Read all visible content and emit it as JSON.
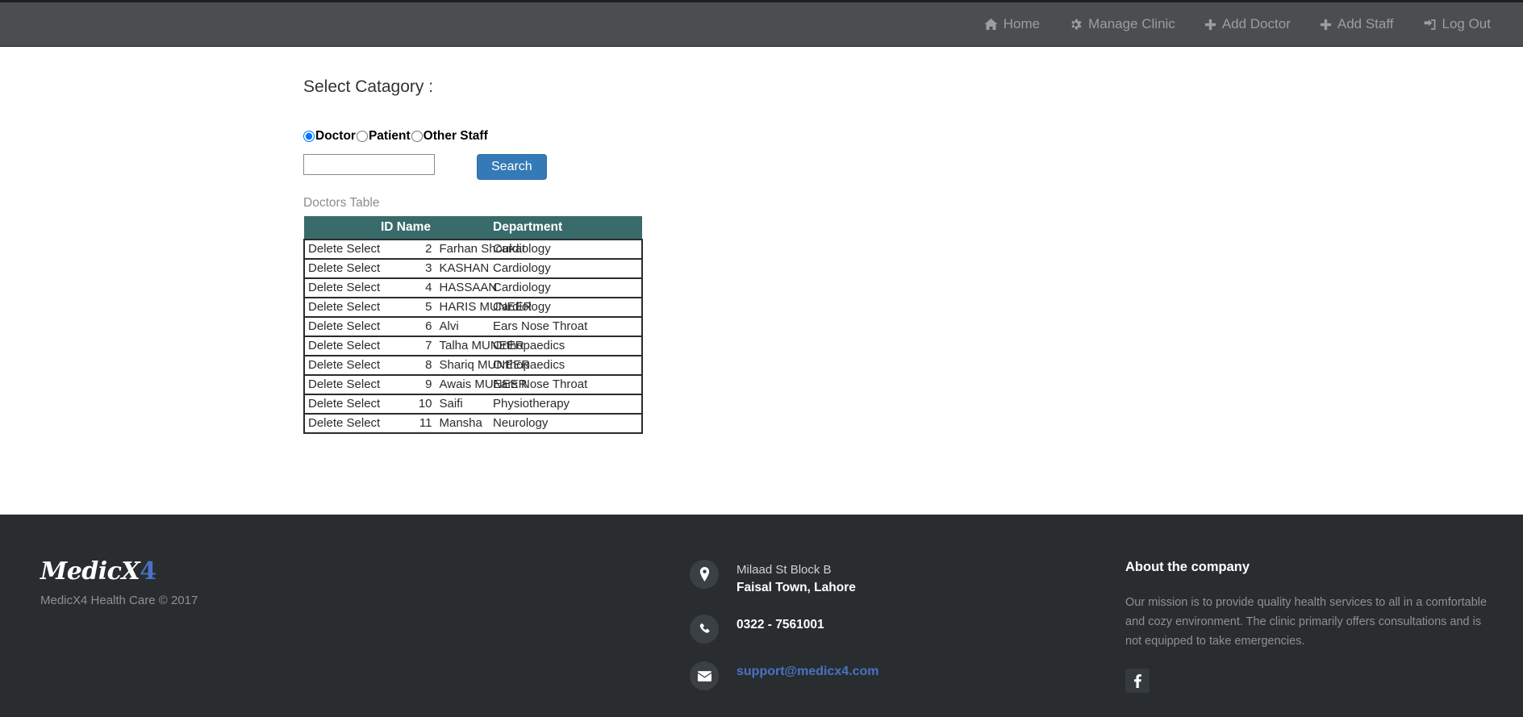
{
  "navbar": {
    "items": [
      {
        "label": "Home",
        "icon": "home-icon"
      },
      {
        "label": "Manage Clinic",
        "icon": "gear-icon"
      },
      {
        "label": "Add Doctor",
        "icon": "plus-icon"
      },
      {
        "label": "Add Staff",
        "icon": "plus-icon"
      },
      {
        "label": "Log Out",
        "icon": "logout-icon"
      }
    ],
    "background": "#4a4e51",
    "text_color": "#9d9d9d"
  },
  "main": {
    "title": "Select Catagory :",
    "radios": [
      {
        "label": "Doctor",
        "checked": true
      },
      {
        "label": "Patient",
        "checked": false
      },
      {
        "label": "Other Staff",
        "checked": false
      }
    ],
    "search": {
      "value": "",
      "placeholder": "",
      "button_label": "Search",
      "button_color": "#337ab7"
    },
    "table": {
      "caption": "Doctors Table",
      "header_color": "#3a6b6b",
      "headers": [
        "",
        "ID Name",
        "Department"
      ],
      "action_labels": {
        "delete": "Delete",
        "select": "Select"
      },
      "rows": [
        {
          "delete": "Delete",
          "select": "Select",
          "id": "2",
          "name": "Farhan Shoukat",
          "department": "Cardiology"
        },
        {
          "delete": "Delete",
          "select": "Select",
          "id": "3",
          "name": "KASHAN",
          "department": "Cardiology"
        },
        {
          "delete": "Delete",
          "select": "Select",
          "id": "4",
          "name": "HASSAAN",
          "department": "Cardiology"
        },
        {
          "delete": "Delete",
          "select": "Select",
          "id": "5",
          "name": "HARIS MUNEER",
          "department": "Cardiology"
        },
        {
          "delete": "Delete",
          "select": "Select",
          "id": "6",
          "name": "Alvi",
          "department": "Ears Nose Throat"
        },
        {
          "delete": "Delete",
          "select": "Select",
          "id": "7",
          "name": "Talha MUNEER",
          "department": "Orthopaedics"
        },
        {
          "delete": "Delete",
          "select": "Select",
          "id": "8",
          "name": "Shariq MUNEER",
          "department": "Orthopaedics"
        },
        {
          "delete": "Delete",
          "select": "Select",
          "id": "9",
          "name": "Awais MUNEER",
          "department": "Ears Nose Throat"
        },
        {
          "delete": "Delete",
          "select": "Select",
          "id": "10",
          "name": "Saifi",
          "department": "Physiotherapy"
        },
        {
          "delete": "Delete",
          "select": "Select",
          "id": "11",
          "name": "Mansha",
          "department": "Neurology"
        }
      ]
    }
  },
  "footer": {
    "background": "#292d30",
    "brand": {
      "logo_main": "MedicX",
      "logo_accent": "4",
      "accent_color": "#4a72c4",
      "copyright": "MedicX4 Health Care © 2017"
    },
    "contact": {
      "address_line1": "Milaad St Block B",
      "address_line2": "Faisal Town, Lahore",
      "phone": "0322 - 7561001",
      "email": "support@medicx4.com"
    },
    "about": {
      "title": "About the company",
      "text": "Our mission is to provide quality health services to all in a comfortable and cozy environment. The clinic primarily offers consultations and is not equipped to take emergencies.",
      "social": [
        {
          "name": "facebook-icon",
          "label": "f"
        }
      ]
    }
  }
}
